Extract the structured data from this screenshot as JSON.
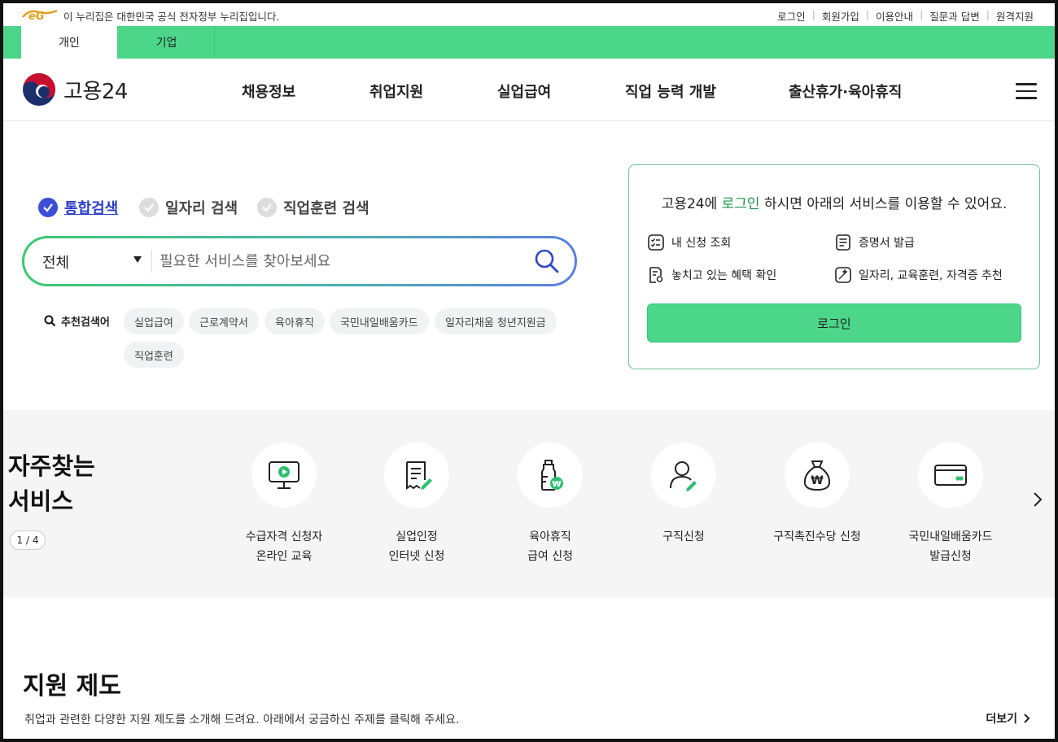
{
  "util": {
    "gov_notice": "이 누리집은 대한민국 공식 전자정부 누리집입니다.",
    "links": [
      "로그인",
      "회원가입",
      "이용안내",
      "질문과 답변",
      "원격지원"
    ]
  },
  "tabs": {
    "personal": "개인",
    "business": "기업"
  },
  "header": {
    "brand": "고용24",
    "nav": [
      "채용정보",
      "취업지원",
      "실업급여",
      "직업 능력 개발",
      "출산휴가·육아휴직"
    ]
  },
  "search": {
    "types": [
      "통합검색",
      "일자리 검색",
      "직업훈련 검색"
    ],
    "scope": "전체",
    "placeholder": "필요한 서비스를 찾아보세요",
    "recommended_label": "추천검색어",
    "keywords": [
      "실업급여",
      "근로계약서",
      "육아휴직",
      "국민내일배움카드",
      "일자리채움 청년지원금",
      "직업훈련"
    ]
  },
  "login_box": {
    "msg_prefix": "고용24에 ",
    "msg_link": "로그인",
    "msg_suffix": " 하시면 아래의 서비스를 이용할 수 있어요.",
    "services": [
      "내 신청 조회",
      "증명서 발급",
      "놓치고 있는 혜택 확인",
      "일자리, 교육훈련, 자격증 추천"
    ],
    "button": "로그인"
  },
  "frequent": {
    "title_line1": "자주찾는",
    "title_line2": "서비스",
    "pager": "1 / 4",
    "items": [
      {
        "line1": "수급자격 신청자",
        "line2": "온라인 교육",
        "icon": "monitor-play-icon"
      },
      {
        "line1": "실업인정",
        "line2": "인터넷 신청",
        "icon": "document-edit-icon"
      },
      {
        "line1": "육아휴직",
        "line2": "급여 신청",
        "icon": "baby-bottle-won-icon"
      },
      {
        "line1": "구직신청",
        "line2": "",
        "icon": "person-edit-icon"
      },
      {
        "line1": "구직촉진수당 신청",
        "line2": "",
        "icon": "money-bag-won-icon"
      },
      {
        "line1": "국민내일배움카드",
        "line2": "발급신청",
        "icon": "card-icon"
      }
    ]
  },
  "support": {
    "title": "지원 제도",
    "desc": "취업과 관련한 다양한 지원 제도를 소개해 드려요. 아래에서 궁금하신 주제를 클릭해 주세요.",
    "more": "더보기"
  },
  "colors": {
    "brand_green": "#4cd68a",
    "accent_blue": "#3a4fd6",
    "link_green": "#1f8f4a"
  }
}
